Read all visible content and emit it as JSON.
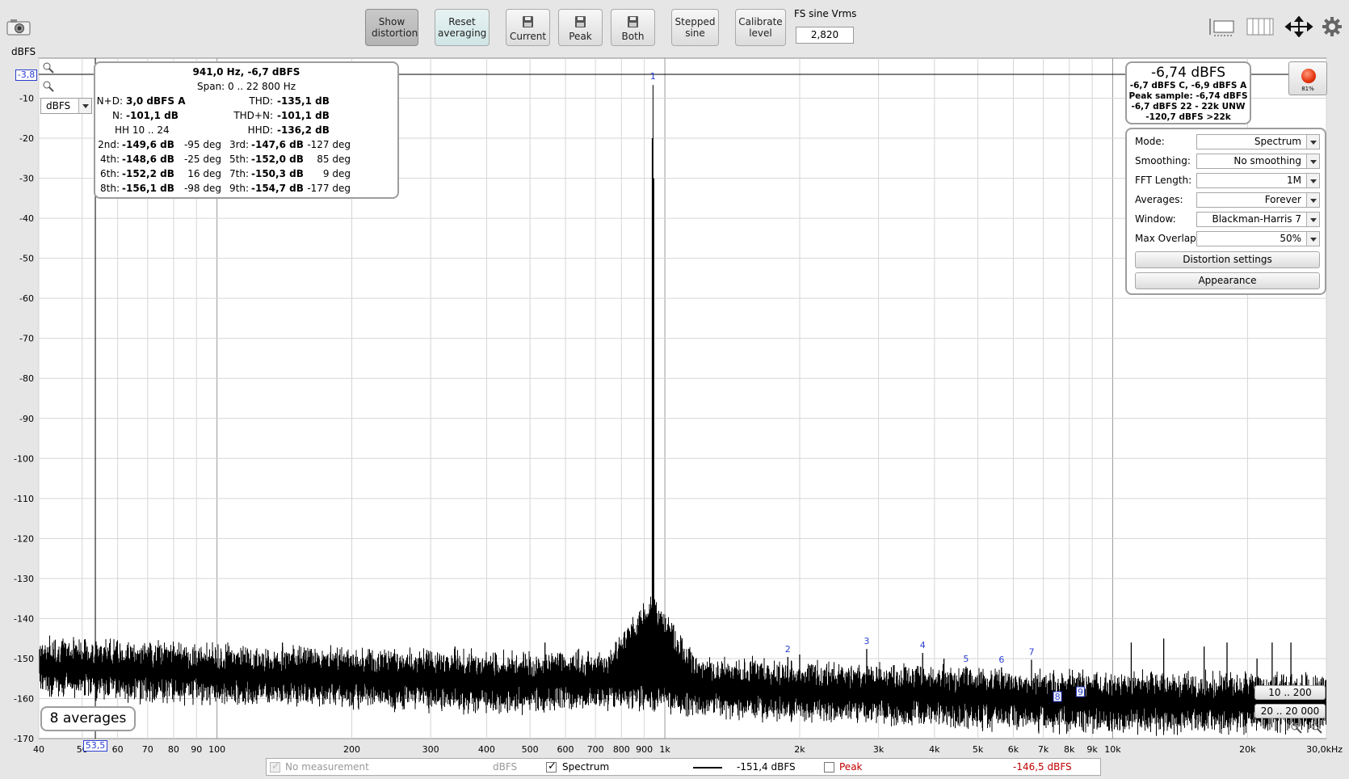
{
  "toolbar": {
    "show_distortion": "Show distortion",
    "reset_averaging": "Reset averaging",
    "current": "Current",
    "peak": "Peak",
    "both": "Both",
    "stepped_sine": "Stepped sine",
    "calibrate_level": "Calibrate level",
    "fs_label": "FS sine Vrms",
    "fs_value": "2,820"
  },
  "plot": {
    "y_unit": "dBFS",
    "cursor_level": "-3,8",
    "cursor_freq": "53,5",
    "unit_select": "dBFS"
  },
  "distortion": {
    "title": "941,0 Hz, -6,7 dBFS",
    "span": "Span:  0 .. 22 800 Hz",
    "nd_label": "N+D:",
    "nd_value": "3,0 dBFS A",
    "thd_label": "THD:",
    "thd_value": "-135,1 dB",
    "n_label": "N:",
    "n_value": "-101,1 dB",
    "thdn_label": "THD+N:",
    "thdn_value": "-101,1 dB",
    "hh_label": "HH 10 .. 24",
    "hhd_label": "HHD:",
    "hhd_value": "-136,2 dB",
    "harmonics": [
      {
        "label": "2nd:",
        "value": "-149,6 dB",
        "phase": "-95 deg"
      },
      {
        "label": "3rd:",
        "value": "-147,6 dB",
        "phase": "-127 deg"
      },
      {
        "label": "4th:",
        "value": "-148,6 dB",
        "phase": "-25 deg"
      },
      {
        "label": "5th:",
        "value": "-152,0 dB",
        "phase": "85 deg"
      },
      {
        "label": "6th:",
        "value": "-152,2 dB",
        "phase": "16 deg"
      },
      {
        "label": "7th:",
        "value": "-150,3 dB",
        "phase": "9 deg"
      },
      {
        "label": "8th:",
        "value": "-156,1 dB",
        "phase": "-98 deg"
      },
      {
        "label": "9th:",
        "value": "-154,7 dB",
        "phase": "-177 deg"
      }
    ]
  },
  "level": {
    "main": "-6,74 dBFS",
    "line1": "-6,7 dBFS C, -6,9 dBFS A",
    "line2": "Peak sample: -6,74 dBFS",
    "line3": "-6,7 dBFS 22 - 22k UNW",
    "line4": "-120,7 dBFS >22k",
    "rec_pct": "81%"
  },
  "settings": {
    "mode_label": "Mode:",
    "mode_value": "Spectrum",
    "smoothing_label": "Smoothing:",
    "smoothing_value": "No  smoothing",
    "fft_label": "FFT Length:",
    "fft_value": "1M",
    "averages_label": "Averages:",
    "averages_value": "Forever",
    "window_label": "Window:",
    "window_value": "Blackman-Harris 7",
    "overlap_label": "Max Overlap:",
    "overlap_value": "50%",
    "distortion_settings": "Distortion settings",
    "appearance": "Appearance"
  },
  "averages_badge": "8 averages",
  "range_buttons": {
    "r1": "10 .. 200",
    "r2": "20 .. 20 000"
  },
  "legend": {
    "no_measurement": "No measurement",
    "no_measurement_unit": "dBFS",
    "spectrum": "Spectrum",
    "spectrum_value": "-151,4 dBFS",
    "peak": "Peak",
    "peak_value": "-146,5 dBFS"
  },
  "chart_data": {
    "type": "line",
    "xlabel": "",
    "ylabel": "dBFS",
    "xscale": "log",
    "xlim": [
      40,
      30000
    ],
    "ylim": [
      -170,
      0
    ],
    "x_ticks": [
      "40",
      "50",
      "60",
      "70",
      "80",
      "90",
      "100",
      "200",
      "300",
      "400",
      "500",
      "600",
      "700",
      "800",
      "900",
      "1k",
      "2k",
      "3k",
      "4k",
      "5k",
      "6k",
      "7k",
      "8k",
      "9k",
      "10k",
      "20k",
      "30,0kHz"
    ],
    "y_ticks": [
      "-10",
      "-20",
      "-30",
      "-40",
      "-50",
      "-60",
      "-70",
      "-80",
      "-90",
      "-100",
      "-110",
      "-120",
      "-130",
      "-140",
      "-150",
      "-160",
      "-170"
    ],
    "noise_floor": {
      "x": [
        40,
        100,
        500,
        900,
        1100,
        3000,
        10000,
        30000
      ],
      "y": [
        -151,
        -153,
        -155,
        -154,
        -156,
        -158,
        -160,
        -160
      ]
    },
    "fundamental": {
      "x": 941,
      "y": -6.7
    },
    "harmonic_markers": [
      {
        "label": "1",
        "x": 941,
        "y": -3.2
      },
      {
        "label": "2",
        "x": 1882,
        "y": -149.6
      },
      {
        "label": "3",
        "x": 2823,
        "y": -147.6
      },
      {
        "label": "4",
        "x": 3764,
        "y": -148.6
      },
      {
        "label": "5",
        "x": 4705,
        "y": -152.0
      },
      {
        "label": "6",
        "x": 5646,
        "y": -152.2
      },
      {
        "label": "7",
        "x": 6587,
        "y": -150.3
      },
      {
        "label": "8",
        "x": 7528,
        "y": -156.1
      },
      {
        "label": "9",
        "x": 8469,
        "y": -154.7
      }
    ],
    "spurs": [
      {
        "x": 140,
        "y": -146
      },
      {
        "x": 340,
        "y": -147
      },
      {
        "x": 540,
        "y": -146
      },
      {
        "x": 2000,
        "y": -149
      },
      {
        "x": 4200,
        "y": -150
      },
      {
        "x": 11000,
        "y": -146
      },
      {
        "x": 13000,
        "y": -145
      },
      {
        "x": 16000,
        "y": -147
      },
      {
        "x": 18000,
        "y": -146
      },
      {
        "x": 21000,
        "y": -150
      },
      {
        "x": 22700,
        "y": -146
      },
      {
        "x": 25000,
        "y": -146
      }
    ]
  }
}
